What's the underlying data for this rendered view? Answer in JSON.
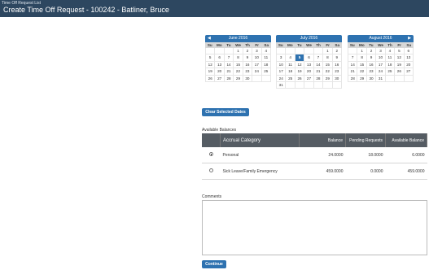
{
  "header": {
    "breadcrumb": "Time Off Request List",
    "title": "Create Time Off Request - 100242 - Batliner, Bruce"
  },
  "calendars": [
    {
      "month": "June 2016",
      "prev_icon": "◀",
      "next_icon": "",
      "days": [
        "",
        "",
        "",
        "1",
        "2",
        "3",
        "4",
        "5",
        "6",
        "7",
        "8",
        "9",
        "10",
        "11",
        "12",
        "13",
        "14",
        "15",
        "16",
        "17",
        "18",
        "19",
        "20",
        "21",
        "22",
        "23",
        "24",
        "25",
        "26",
        "27",
        "28",
        "29",
        "30",
        "",
        ""
      ]
    },
    {
      "month": "July 2016",
      "prev_icon": "",
      "next_icon": "",
      "days": [
        "",
        "",
        "",
        "",
        "",
        "1",
        "2",
        "3",
        "4",
        "5",
        "6",
        "7",
        "8",
        "9",
        "10",
        "11",
        "12",
        "13",
        "14",
        "15",
        "16",
        "17",
        "18",
        "19",
        "20",
        "21",
        "22",
        "23",
        "24",
        "25",
        "26",
        "27",
        "28",
        "29",
        "30",
        "31",
        "",
        "",
        "",
        "",
        "",
        ""
      ]
    },
    {
      "month": "August 2016",
      "prev_icon": "",
      "next_icon": "▶",
      "days": [
        "",
        "1",
        "2",
        "3",
        "4",
        "5",
        "6",
        "7",
        "8",
        "9",
        "10",
        "11",
        "12",
        "13",
        "14",
        "15",
        "16",
        "17",
        "18",
        "19",
        "20",
        "21",
        "22",
        "23",
        "24",
        "25",
        "26",
        "27",
        "28",
        "29",
        "30",
        "31",
        "",
        "",
        ""
      ]
    }
  ],
  "weekdays": [
    "Su",
    "Mo",
    "Tu",
    "We",
    "Th",
    "Fr",
    "Sa"
  ],
  "selected_date": {
    "calendar": 1,
    "day": "5"
  },
  "clear_button": "Clear Selected Dates",
  "balances": {
    "label": "Available Balances",
    "columns": [
      "",
      "Accrual Category",
      "Balance",
      "Pending Requests",
      "Available Balance"
    ],
    "rows": [
      {
        "selected": true,
        "category": "Personal",
        "balance": "24.0000",
        "pending": "18.0000",
        "available": "6.0000"
      },
      {
        "selected": false,
        "category": "Sick Leave/Family Emergency",
        "balance": "459.0000",
        "pending": "0.0000",
        "available": "459.0000"
      }
    ]
  },
  "comments": {
    "label": "Comments",
    "value": ""
  },
  "continue_button": "Continue",
  "colors": {
    "header_bg": "#2d4760",
    "accent": "#2e72b0",
    "table_header": "#555c63"
  }
}
